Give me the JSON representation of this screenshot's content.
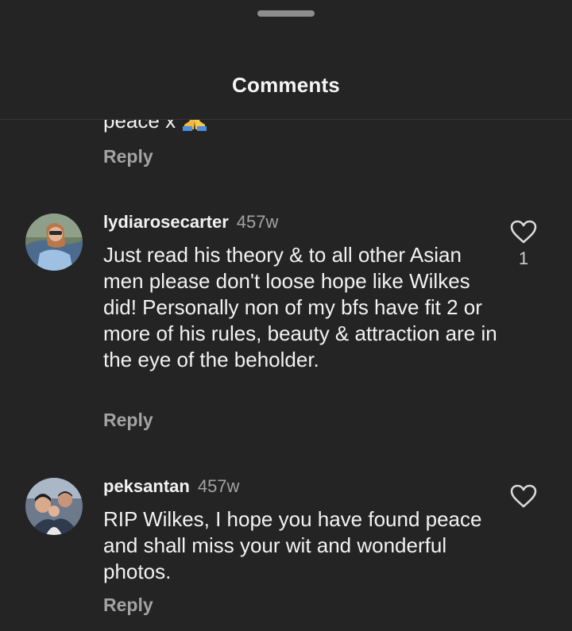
{
  "header": {
    "title": "Comments"
  },
  "previous_comment": {
    "text_fragment": "peace x",
    "emoji": "folded-hands-emoji",
    "reply_label": "Reply"
  },
  "comments": [
    {
      "username": "lydiarosecarter",
      "time": "457w",
      "text": "Just read his theory & to all other Asian men please don't loose hope like Wilkes did! Personally non of my bfs have fit 2 or more of his rules, beauty & attraction are in the eye of the beholder.",
      "likes": "1",
      "reply_label": "Reply",
      "avatar": "woman-with-sunglasses-avatar",
      "like_icon": "heart-outline-icon"
    },
    {
      "username": "peksantan",
      "time": "457w",
      "text": "RIP Wilkes, I hope you have found peace and shall miss your wit and wonderful photos.",
      "likes": "",
      "reply_label": "Reply",
      "avatar": "family-photo-avatar",
      "like_icon": "heart-outline-icon"
    }
  ],
  "colors": {
    "background": "#242424",
    "primary_text": "#f2f2f2",
    "secondary_text": "#a3a3a3"
  }
}
